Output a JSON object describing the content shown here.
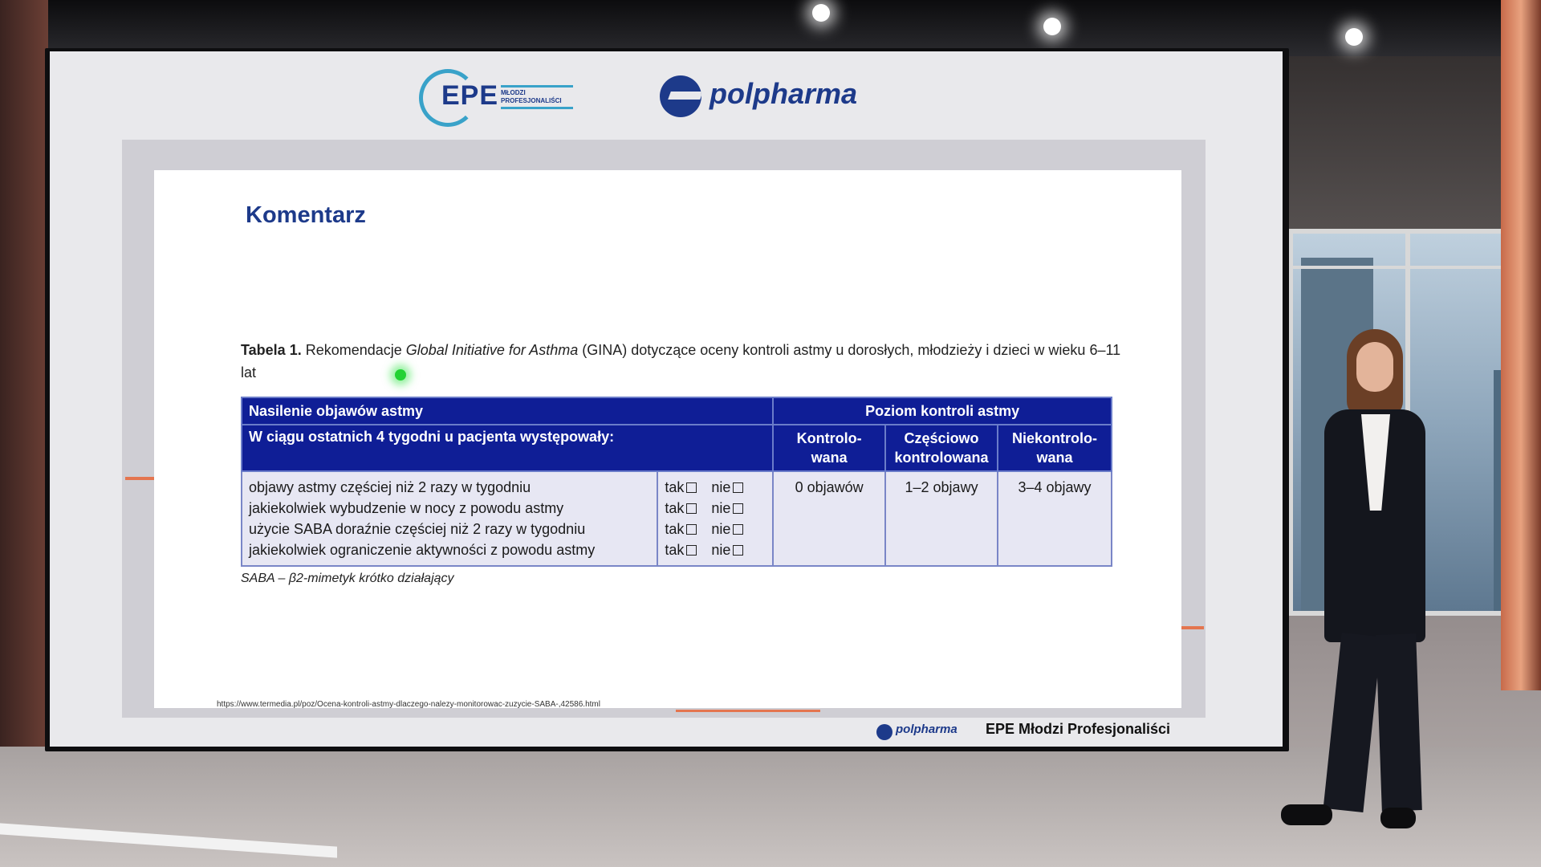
{
  "logos": {
    "epe": "EPE",
    "epe_sub": "MŁODZI PROFESJONALIŚCI",
    "polpharma": "polpharma"
  },
  "slide": {
    "title": "Komentarz",
    "caption": {
      "label": "Tabela 1.",
      "text_before": " Rekomendacje ",
      "italic": "Global Initiative for Asthma",
      "text_after": " (GINA) dotyczące oceny kontroli astmy u dorosłych, młodzieży i dzieci w wieku 6–11 lat"
    },
    "table": {
      "header_left_1": "Nasilenie objawów astmy",
      "header_left_2": "W ciągu ostatnich 4 tygodni u pacjenta występowały:",
      "header_right": "Poziom kontroli astmy",
      "levels": [
        "Kontrolo-\nwana",
        "Częściowo\nkontrolowana",
        "Niekontrolo-\nwana"
      ],
      "questions": [
        "objawy astmy częściej niż 2 razy w tygodniu",
        "jakiekolwiek wybudzenie w nocy z powodu astmy",
        "użycie SABA doraźnie częściej niż 2 razy w tygodniu",
        "jakiekolwiek ograniczenie aktywności z powodu astmy"
      ],
      "yes_label": "tak",
      "no_label": "nie",
      "values": [
        "0 objawów",
        "1–2 objawy",
        "3–4 objawy"
      ]
    },
    "footnote": "SABA – β2-mimetyk krótko działający",
    "source_url": "https://www.termedia.pl/poz/Ocena-kontroli-astmy-dlaczego-nalezy-monitorowac-zuzycie-SABA-,42586.html"
  },
  "footer": {
    "polpharma": "polpharma",
    "epe": "EPE Młodzi Profesjonaliści"
  },
  "colors": {
    "brand_blue": "#1d3a8a",
    "table_header": "#0f1e96",
    "accent": "#e4754f",
    "cursor": "#22d233"
  }
}
